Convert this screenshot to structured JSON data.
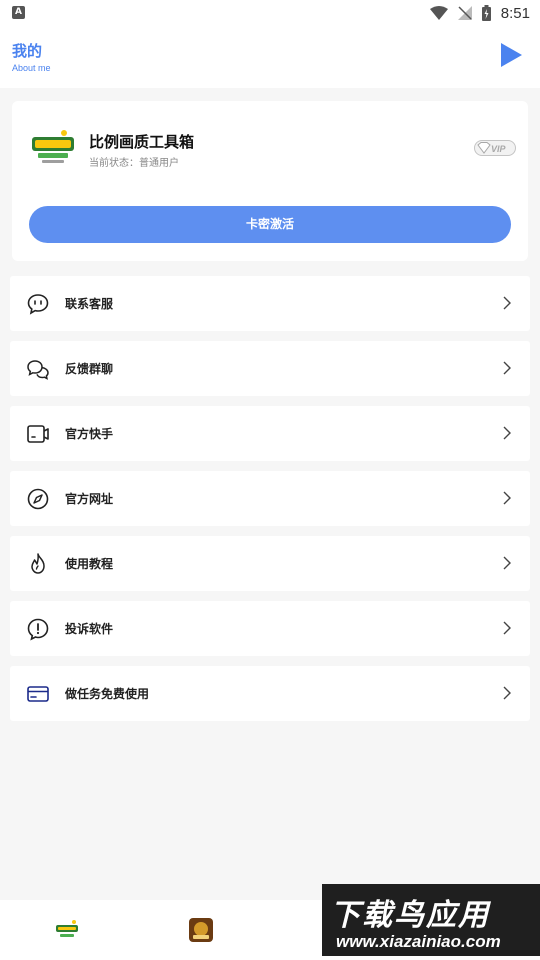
{
  "status_bar": {
    "time": "8:51",
    "icons": [
      "app-notification-icon",
      "wifi-icon",
      "signal-icon",
      "battery-icon"
    ]
  },
  "header": {
    "title": "我的",
    "subtitle": "About me",
    "action_icon": "play-icon",
    "accent_color": "#4b83ef"
  },
  "profile": {
    "app_name": "比例画质工具箱",
    "status": "当前状态：普通用户",
    "badge": "VIP",
    "activate_label": "卡密激活",
    "button_color": "#5e8ff0"
  },
  "menu": {
    "items": [
      {
        "label": "联系客服",
        "icon": "chat-bubble-icon"
      },
      {
        "label": "反馈群聊",
        "icon": "group-chat-icon"
      },
      {
        "label": "官方快手",
        "icon": "video-camera-icon"
      },
      {
        "label": "官方网址",
        "icon": "compass-icon"
      },
      {
        "label": "使用教程",
        "icon": "flame-icon"
      },
      {
        "label": "投诉软件",
        "icon": "alert-circle-icon"
      },
      {
        "label": "做任务免费使用",
        "icon": "card-icon"
      }
    ]
  },
  "bottom_bar": {
    "tabs": [
      "app-tab-icon",
      "game-tab-icon"
    ]
  },
  "watermark": {
    "title": "下载鸟应用",
    "url": "www.xiazainiao.com"
  }
}
